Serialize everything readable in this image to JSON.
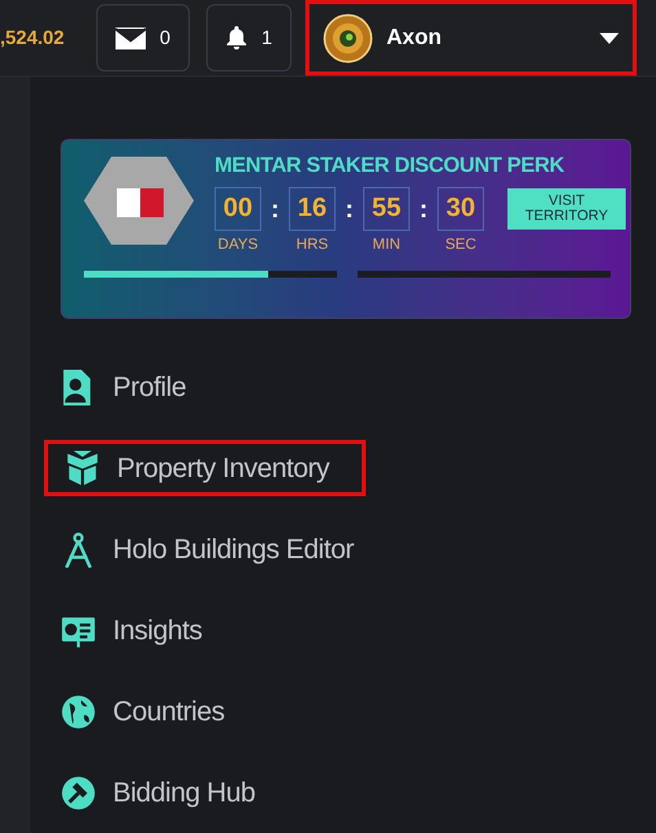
{
  "balance": ",524.02",
  "messages": {
    "count": "0"
  },
  "notifications": {
    "count": "1"
  },
  "user": {
    "name": "Axon",
    "highlighted": true
  },
  "perk": {
    "title": "MENTAR STAKER DISCOUNT PERK",
    "countdown": [
      {
        "value": "00",
        "unit": "DAYS"
      },
      {
        "value": "16",
        "unit": "HRS"
      },
      {
        "value": "55",
        "unit": "MIN"
      },
      {
        "value": "30",
        "unit": "SEC"
      }
    ],
    "separator": ":",
    "button": "VISIT\nTERRITORY",
    "bars": [
      {
        "level": 0.73
      },
      {
        "level": 0
      }
    ]
  },
  "menu": [
    {
      "label": "Profile",
      "kind": "profile",
      "highlighted": false
    },
    {
      "label": "Property Inventory",
      "kind": "box",
      "highlighted": true
    },
    {
      "label": "Holo Buildings Editor",
      "kind": "compass",
      "highlighted": false
    },
    {
      "label": "Insights",
      "kind": "board",
      "highlighted": false
    },
    {
      "label": "Countries",
      "kind": "globe",
      "highlighted": false
    },
    {
      "label": "Bidding Hub",
      "kind": "gavel",
      "highlighted": false
    }
  ]
}
